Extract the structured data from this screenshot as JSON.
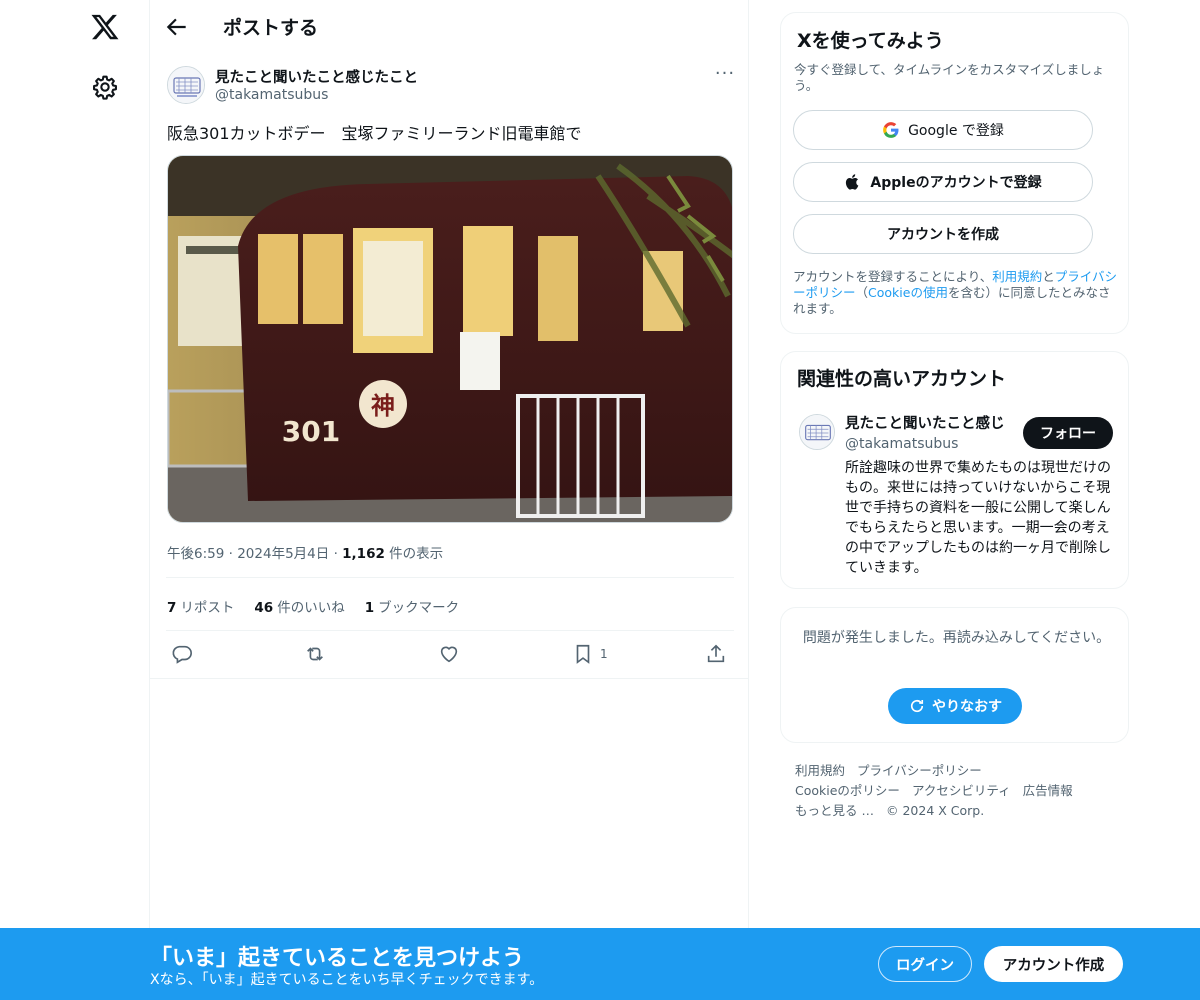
{
  "nav": {
    "logo_icon": "x-logo-icon",
    "settings_icon": "gear-icon"
  },
  "header": {
    "title": "ポストする"
  },
  "post": {
    "author_name": "見たこと聞いたこと感じたこと",
    "author_handle": "@takamatsubus",
    "text": "阪急301カットボデー　宝塚ファミリーランド旧電車館で",
    "image_number": "301",
    "image_emblem": "神",
    "time": "午後6:59",
    "date": "2024年5月4日",
    "views_count": "1,162",
    "views_label": "件の表示",
    "reposts_count": "7",
    "reposts_label": "リポスト",
    "likes_count": "46",
    "likes_label": "件のいいね",
    "bookmarks_count": "1",
    "bookmarks_label": "ブックマーク",
    "bookmark_action_count": "1"
  },
  "signup_card": {
    "title": "Xを使ってみよう",
    "subtitle": "今すぐ登録して、タイムラインをカスタマイズしましょう。",
    "google_label": "Google で登録",
    "apple_label": "Appleのアカウントで登録",
    "create_label": "アカウントを作成",
    "terms_prefix": "アカウントを登録することにより、",
    "terms_link": "利用規約",
    "terms_and": "と",
    "privacy_link": "プライバシーポリシー",
    "cookie_open": "（",
    "cookie_link": "Cookieの使用",
    "cookie_close": "を含む）に同意したとみなされます。"
  },
  "related_card": {
    "title": "関連性の高いアカウント",
    "name": "見たこと聞いたこと感じ",
    "handle": "@takamatsubus",
    "follow_label": "フォロー",
    "bio": "所詮趣味の世界で集めたものは現世だけのもの。来世には持っていけないからこそ現世で手持ちの資料を一般に公開して楽しんでもらえたらと思います。一期一会の考えの中でアップしたものは約一ヶ月で削除していきます。"
  },
  "error_card": {
    "message": "問題が発生しました。再読み込みしてください。",
    "retry_label": "やりなおす"
  },
  "footer": {
    "terms": "利用規約",
    "privacy": "プライバシーポリシー",
    "cookie": "Cookieのポリシー",
    "accessibility": "アクセシビリティ",
    "ads": "広告情報",
    "more": "もっと見る …",
    "copyright": "© 2024 X Corp."
  },
  "bottom_bar": {
    "title": "「いま」起きていることを見つけよう",
    "subtitle": "Xなら、「いま」起きていることをいち早くチェックできます。",
    "login_label": "ログイン",
    "signup_label": "アカウント作成"
  },
  "colors": {
    "accent": "#1d9bf0",
    "text": "#0f1419",
    "secondary": "#536471",
    "border": "#eff3f4"
  }
}
